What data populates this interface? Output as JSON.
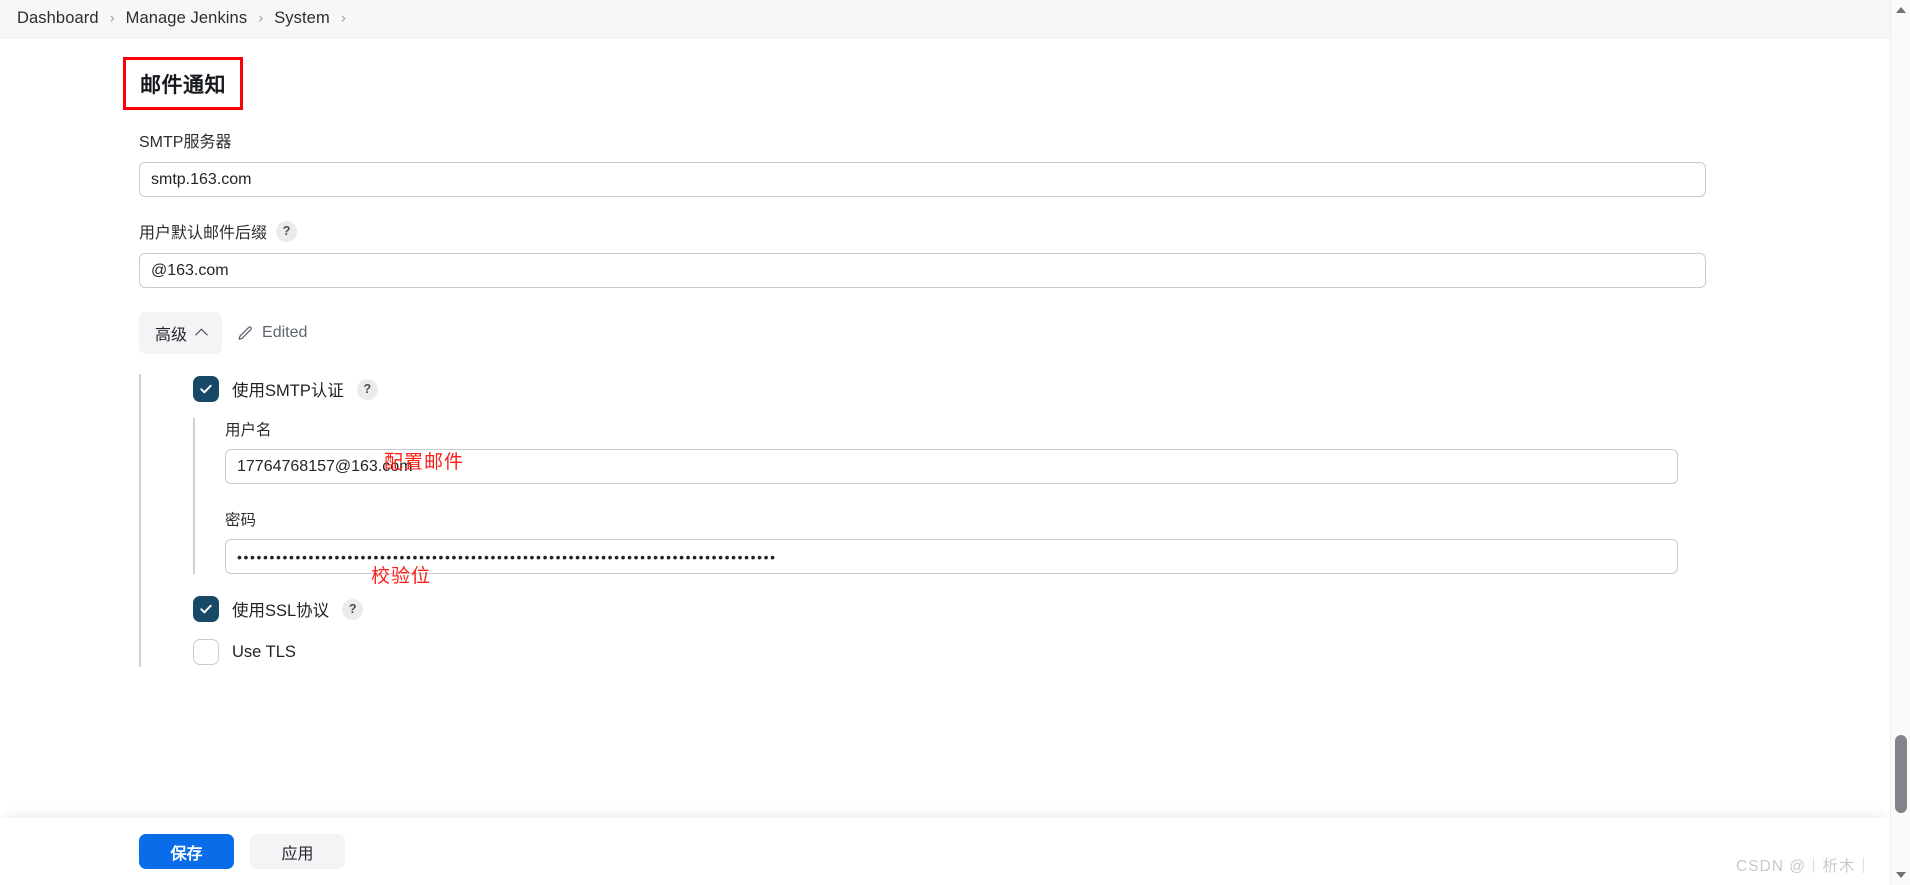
{
  "breadcrumb": {
    "items": [
      {
        "label": "Dashboard"
      },
      {
        "label": "Manage Jenkins"
      },
      {
        "label": "System"
      }
    ],
    "separator": "›"
  },
  "section": {
    "title": "邮件通知",
    "highlight_color": "#fb0007"
  },
  "fields": {
    "smtp_server": {
      "label": "SMTP服务器",
      "value": "smtp.163.com",
      "placeholder": ""
    },
    "default_suffix": {
      "label": "用户默认邮件后缀",
      "value": "@163.com",
      "placeholder": "",
      "help": "?"
    }
  },
  "advanced": {
    "toggle_label": "高级",
    "chevron": "chevron-up-icon",
    "edited_label": "Edited",
    "smtp_auth": {
      "label": "使用SMTP认证",
      "checked": true,
      "help": "?"
    },
    "username": {
      "label": "用户名",
      "value": "17764768157@163.com",
      "placeholder": ""
    },
    "password": {
      "label": "密码",
      "value": "•••••••••••••••••••••••••••••••••••••••••••••••••••••••••••••••••••••••••••••••••••",
      "placeholder": ""
    },
    "use_ssl": {
      "label": "使用SSL协议",
      "checked": true,
      "help": "?"
    },
    "use_tls": {
      "label": "Use TLS",
      "checked": false
    }
  },
  "annotations": [
    {
      "id": "config-mail",
      "text": "配置邮件",
      "color": "#fb1f15"
    },
    {
      "id": "check-digit",
      "text": "校验位",
      "color": "#fb1f15"
    }
  ],
  "actions": {
    "save_label": "保存",
    "apply_label": "应用",
    "save_color": "#0a6ce8"
  },
  "watermark": {
    "text": "CSDN @｜析木｜"
  }
}
